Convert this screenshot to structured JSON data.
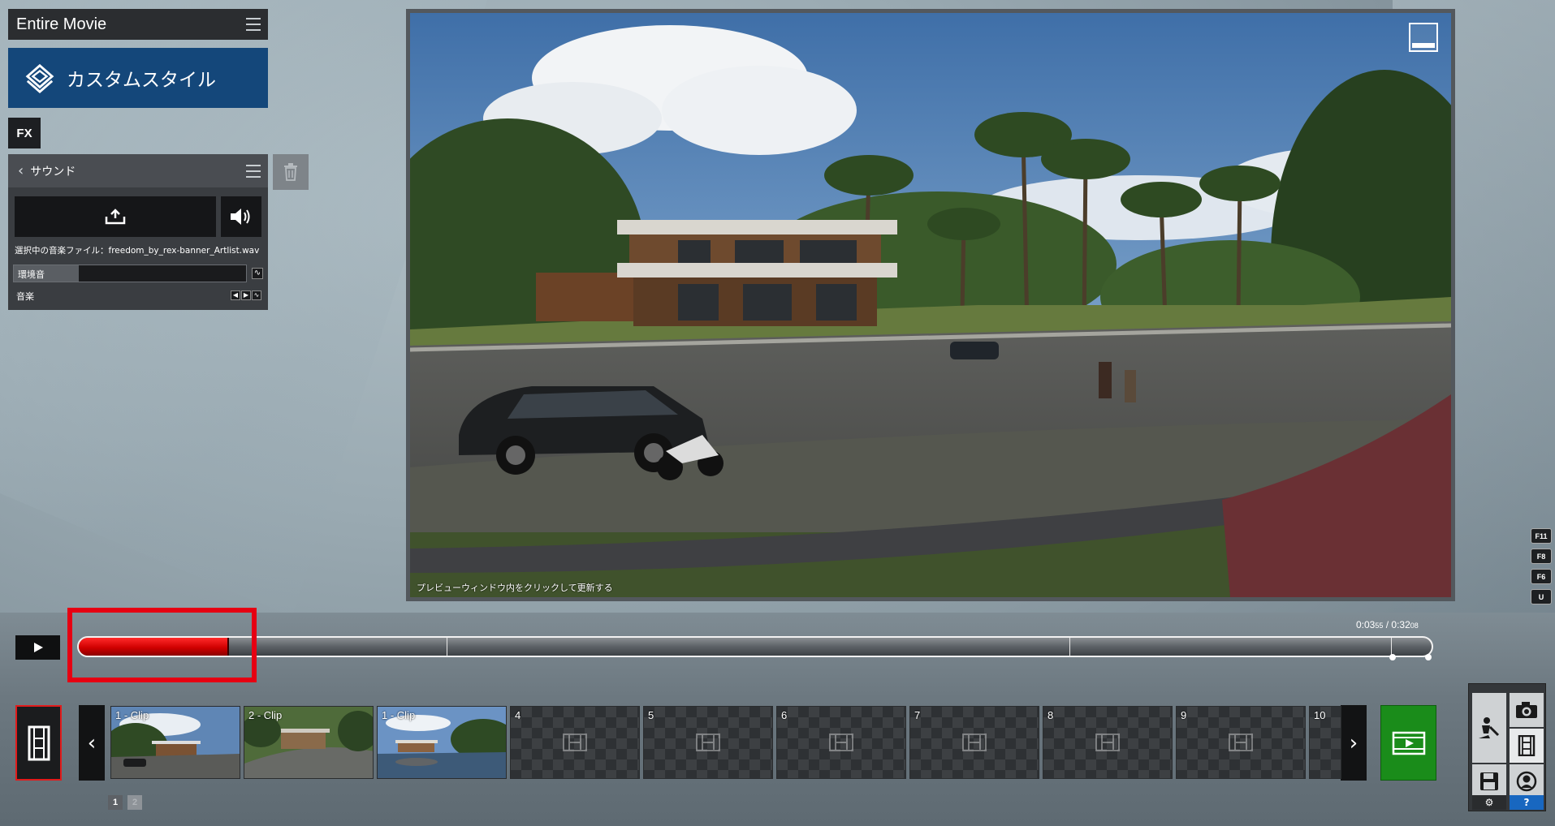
{
  "header": {
    "title": "Entire Movie"
  },
  "style_banner": {
    "label": "カスタムスタイル"
  },
  "fx_button": {
    "label": "FX"
  },
  "sound_panel": {
    "title": "サウンド",
    "selected_file_label": "選択中の音楽ファイル：freedom_by_rex-banner_Artlist.wav",
    "ambient_label": "環境音",
    "ambient_level": 0.28,
    "music_label": "音楽"
  },
  "preview": {
    "caption": "プレビューウィンドウ内をクリックして更新する"
  },
  "shortcuts": [
    "F11",
    "F8",
    "F6",
    "U"
  ],
  "timeline": {
    "time_current": "0:03",
    "time_current_frames": "55",
    "time_total": "0:32",
    "time_total_frames": "08",
    "progress": 0.111,
    "markers": [
      0.272,
      0.732
    ],
    "end_marker": 0.97
  },
  "clips": [
    {
      "label": "1 - Clip",
      "type": "thumb",
      "scene": "street"
    },
    {
      "label": "2 - Clip",
      "type": "thumb",
      "scene": "aerial"
    },
    {
      "label": "1 - Clip",
      "type": "thumb",
      "scene": "lake"
    },
    {
      "label": "4",
      "type": "empty"
    },
    {
      "label": "5",
      "type": "empty"
    },
    {
      "label": "6",
      "type": "empty"
    },
    {
      "label": "7",
      "type": "empty"
    },
    {
      "label": "8",
      "type": "empty"
    },
    {
      "label": "9",
      "type": "empty"
    },
    {
      "label": "10",
      "type": "empty"
    }
  ],
  "pages": [
    "1",
    "2"
  ],
  "tools": {
    "help_label": "?"
  },
  "colors": {
    "progress_red": "#e60012",
    "render_green": "#1a8c1a",
    "banner_blue": "#14477a"
  }
}
